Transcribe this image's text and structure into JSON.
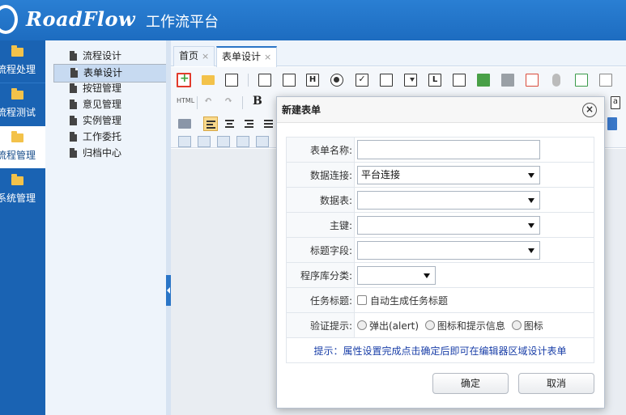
{
  "header": {
    "logo_text": "RoadFlow",
    "title": "工作流平台"
  },
  "leftnav": {
    "items": [
      {
        "label": "流程处理",
        "active": false
      },
      {
        "label": "流程测试",
        "active": false
      },
      {
        "label": "流程管理",
        "active": true
      },
      {
        "label": "系统管理",
        "active": false
      }
    ]
  },
  "tree": {
    "items": [
      {
        "label": "流程设计",
        "selected": false
      },
      {
        "label": "表单设计",
        "selected": true
      },
      {
        "label": "按钮管理",
        "selected": false
      },
      {
        "label": "意见管理",
        "selected": false
      },
      {
        "label": "实例管理",
        "selected": false
      },
      {
        "label": "工作委托",
        "selected": false
      },
      {
        "label": "归档中心",
        "selected": false
      }
    ]
  },
  "tabs": [
    {
      "label": "首页",
      "close": "×",
      "active": false
    },
    {
      "label": "表单设计",
      "close": "×",
      "active": true
    }
  ],
  "toolbar": {
    "html_label": "HTML",
    "bold_label": "B"
  },
  "modal": {
    "title": "新建表单",
    "close": "×",
    "fields": {
      "form_name_label": "表单名称:",
      "form_name_value": "",
      "data_conn_label": "数据连接:",
      "data_conn_value": "平台连接",
      "data_table_label": "数据表:",
      "data_table_value": "",
      "primary_key_label": "主键:",
      "primary_key_value": "",
      "title_field_label": "标题字段:",
      "title_field_value": "",
      "lib_category_label": "程序库分类:",
      "lib_category_value": "",
      "task_title_label": "任务标题:",
      "task_title_option": "自动生成任务标题",
      "validation_label": "验证提示:",
      "validation_options": [
        "弹出(alert)",
        "图标和提示信息",
        "图标"
      ]
    },
    "tip": "提示：属性设置完成点击确定后即可在编辑器区域设计表单",
    "ok_label": "确定",
    "cancel_label": "取消"
  },
  "colors": {
    "header_blue": "#1d6cc0",
    "nav_blue": "#1a63b3",
    "tip_blue": "#1a3fa8",
    "highlight_red": "#e23a2b"
  }
}
